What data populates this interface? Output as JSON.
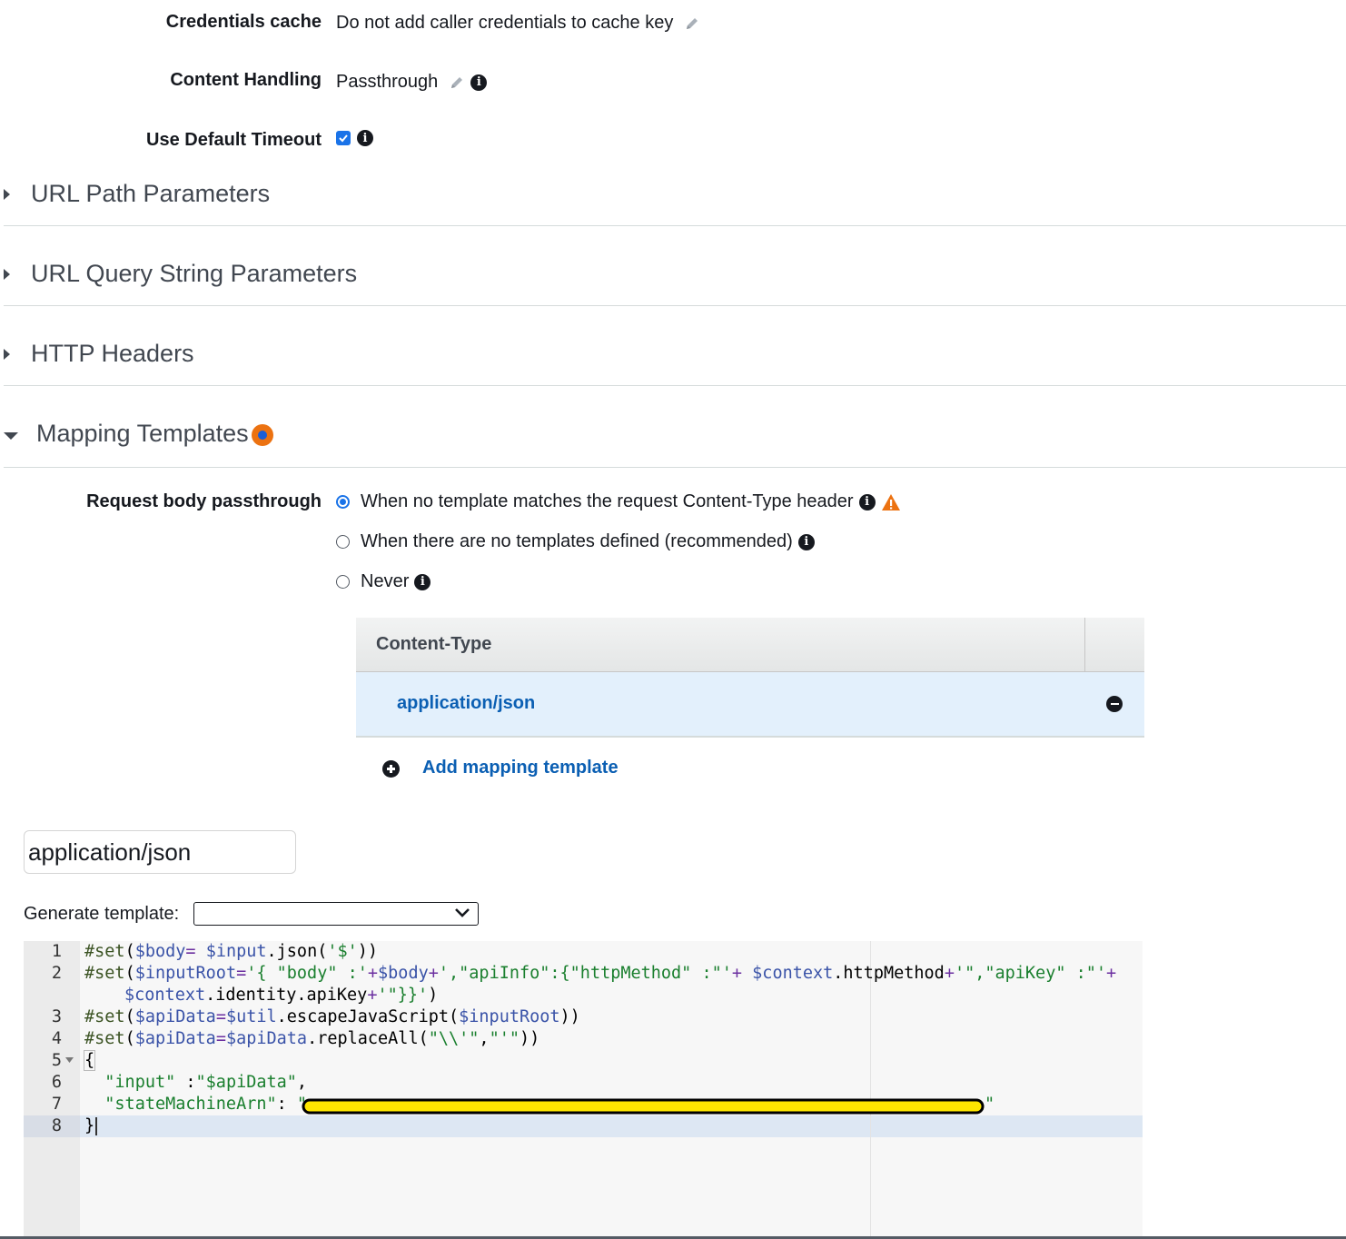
{
  "settings": {
    "credentials_cache": {
      "label": "Credentials cache",
      "value": "Do not add caller credentials to cache key"
    },
    "content_handling": {
      "label": "Content Handling",
      "value": "Passthrough"
    },
    "default_timeout": {
      "label": "Use Default Timeout",
      "checked": true
    }
  },
  "sections": {
    "url_path": "URL Path Parameters",
    "url_query": "URL Query String Parameters",
    "http_headers": "HTTP Headers",
    "mapping_templates": "Mapping Templates"
  },
  "passthrough": {
    "label": "Request body passthrough",
    "options": [
      {
        "label": "When no template matches the request Content-Type header",
        "selected": true
      },
      {
        "label": "When there are no templates defined (recommended)",
        "selected": false
      },
      {
        "label": "Never",
        "selected": false
      }
    ]
  },
  "content_type_table": {
    "header": "Content-Type",
    "rows": [
      "application/json"
    ],
    "add_label": "Add mapping template"
  },
  "template_editor": {
    "content_type_value": "application/json",
    "generate_label": "Generate template:",
    "generate_selected": "",
    "line_numbers": [
      "1",
      "2",
      "",
      "3",
      "4",
      "5",
      "6",
      "7",
      "8"
    ]
  },
  "colors": {
    "link": "#0b5fb3",
    "accent": "#1a73e8",
    "warning": "#ec7211",
    "redaction": "#ffe600"
  }
}
